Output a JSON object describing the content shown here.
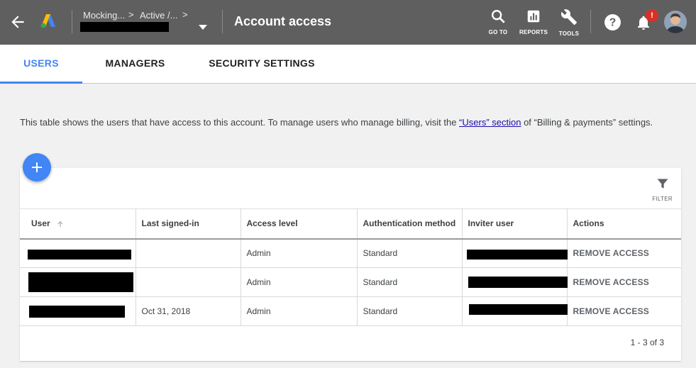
{
  "header": {
    "breadcrumb": [
      "Mocking...",
      "Active /..."
    ],
    "title": "Account access",
    "tools": [
      {
        "icon": "search-icon",
        "label": "GO TO"
      },
      {
        "icon": "reports-icon",
        "label": "REPORTS"
      },
      {
        "icon": "wrench-icon",
        "label": "TOOLS"
      }
    ],
    "notification_badge": "!"
  },
  "tabs": [
    {
      "label": "USERS",
      "active": true
    },
    {
      "label": "MANAGERS",
      "active": false
    },
    {
      "label": "SECURITY SETTINGS",
      "active": false
    }
  ],
  "description": {
    "prefix": "This table shows the users that have access to this account. To manage users who manage billing, visit the ",
    "link": "“Users” section",
    "suffix": " of “Billing & payments” settings."
  },
  "filter_label": "FILTER",
  "table": {
    "columns": [
      "User",
      "Last signed-in",
      "Access level",
      "Authentication method",
      "Inviter user",
      "Actions"
    ],
    "rows": [
      {
        "last_signed_in": "",
        "access_level": "Admin",
        "auth_method": "Standard",
        "action": "REMOVE ACCESS"
      },
      {
        "last_signed_in": "",
        "access_level": "Admin",
        "auth_method": "Standard",
        "action": "REMOVE ACCESS"
      },
      {
        "last_signed_in": "Oct 31, 2018",
        "access_level": "Admin",
        "auth_method": "Standard",
        "action": "REMOVE ACCESS"
      }
    ]
  },
  "pagination": "1 - 3 of 3",
  "colors": {
    "appbar": "#5f5f5f",
    "accent": "#4285f4",
    "badge": "#d93025"
  }
}
